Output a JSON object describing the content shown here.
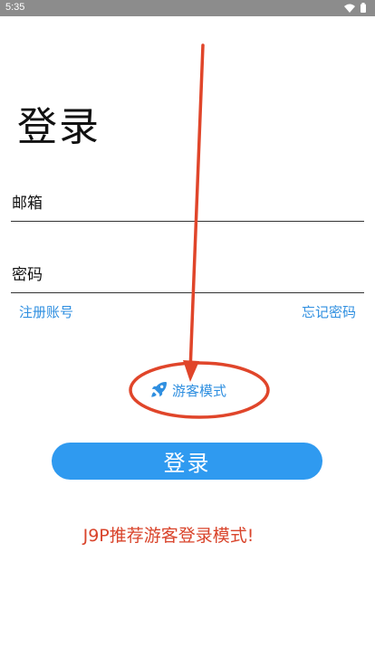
{
  "status_bar": {
    "time": "5:35"
  },
  "login": {
    "title": "登录",
    "email_placeholder": "邮箱",
    "password_placeholder": "密码",
    "register_link": "注册账号",
    "forgot_link": "忘记密码",
    "guest_mode": "游客模式",
    "login_button": "登录"
  },
  "annotation": {
    "text": "J9P推荐游客登录模式!"
  },
  "colors": {
    "accent": "#2f8fe0",
    "button": "#2f9af0",
    "annotation_red": "#d9442b"
  },
  "icons": {
    "guest": "rocket-icon",
    "status": [
      "wifi-icon",
      "battery-icon"
    ]
  }
}
